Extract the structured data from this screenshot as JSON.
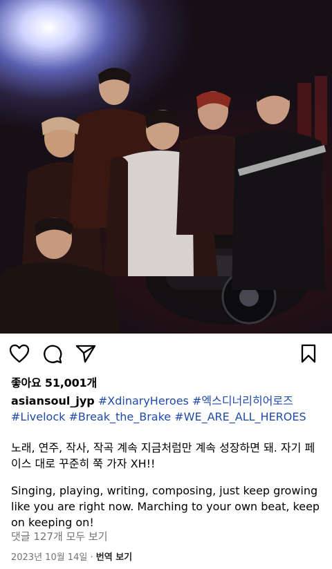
{
  "post": {
    "likes_text": "좋아요 51,001개",
    "username": "asiansoul_jyp",
    "hashtags_line1": [
      "#XdinaryHeroes",
      "#엑스디너리히어로즈"
    ],
    "hashtags_line2": [
      "#Livelock",
      "#Break_the_Brake",
      "#WE_ARE_ALL_HEROES"
    ],
    "caption_korean": "노래, 연주, 작사, 작곡 계속 지금처럼만 계속 성장하면 돼. 자기 페이스 대로 꾸준히 쭉 가자 XH!!",
    "caption_english": "Singing, playing, writing, composing, just keep growing like you are right now. Marching to your own beat, keep on keeping on!",
    "comments_link": "댓글 127개 모두 보기",
    "date": "2023년 10월 14일",
    "separator": "·",
    "translate_label": "번역 보기"
  },
  "actions": {
    "like_icon": "heart-icon",
    "comment_icon": "comment-icon",
    "share_icon": "send-icon",
    "save_icon": "bookmark-icon"
  }
}
